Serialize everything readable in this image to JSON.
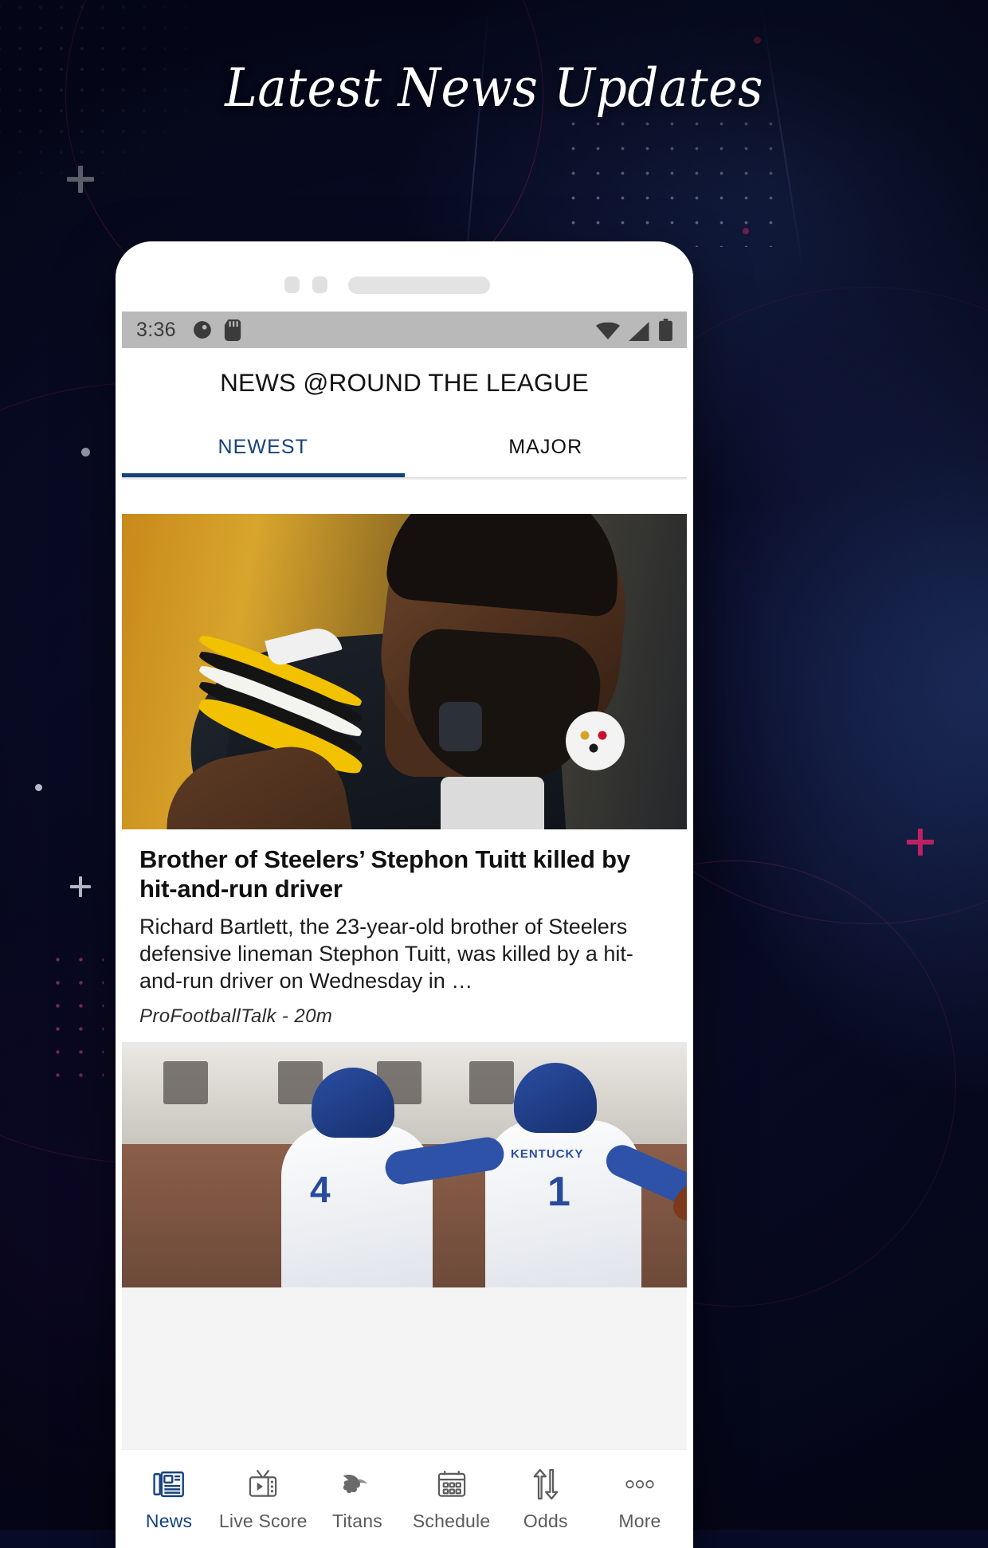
{
  "hero": {
    "title": "Latest News Updates"
  },
  "phone": {
    "camera_dots": 2,
    "speaker_label": "speaker-grill"
  },
  "status_bar": {
    "time": "3:36",
    "left_icons": [
      "do-not-disturb-icon",
      "sd-card-icon"
    ],
    "right_icons": [
      "wifi-icon",
      "cellular-signal-icon",
      "battery-icon"
    ]
  },
  "app_bar": {
    "title": "NEWS @ROUND THE LEAGUE"
  },
  "tabs": {
    "items": [
      {
        "label": "NEWEST",
        "active": true
      },
      {
        "label": "MAJOR",
        "active": false
      }
    ],
    "active_color": "#16427c"
  },
  "feed": {
    "articles": [
      {
        "image_alt": "steelers-player-photo",
        "title": "Brother of Steelers’ Stephon Tuitt killed by hit-and-run driver",
        "description": "Richard Bartlett, the 23-year-old brother of Steelers defensive lineman Stephon Tuitt, was killed by a hit-and-run driver on Wednesday in …",
        "source": "ProFootballTalk - 20m"
      },
      {
        "image_alt": "kentucky-wildcats-players-photo"
      }
    ]
  },
  "bottom_nav": {
    "items": [
      {
        "label": "News",
        "icon": "newspaper-icon",
        "active": true
      },
      {
        "label": "Live Score",
        "icon": "tv-play-icon",
        "active": false
      },
      {
        "label": "Titans",
        "icon": "titans-logo-icon",
        "active": false
      },
      {
        "label": "Schedule",
        "icon": "calendar-icon",
        "active": false
      },
      {
        "label": "Odds",
        "icon": "arrows-up-down-icon",
        "active": false
      },
      {
        "label": "More",
        "icon": "ellipsis-icon",
        "active": false
      }
    ],
    "active_color": "#16427c"
  },
  "colors": {
    "background_deep_navy": "#070b26",
    "accent_magenta": "#c8266e",
    "brand_navy": "#16427c",
    "status_bar_gray": "#b9b9b9"
  }
}
